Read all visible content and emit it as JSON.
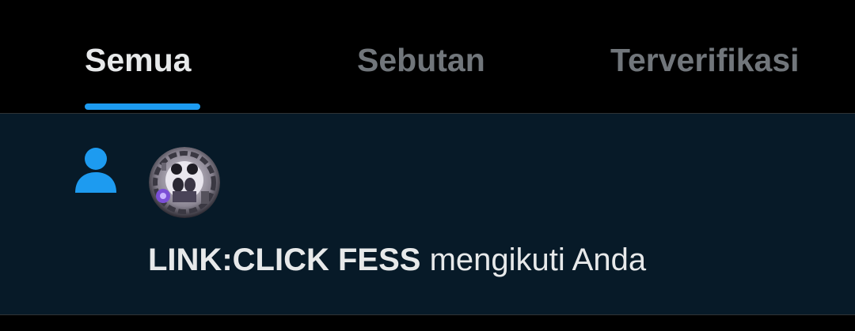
{
  "tabs": {
    "all": "Semua",
    "mentions": "Sebutan",
    "verified": "Terverifikasi",
    "active": "all"
  },
  "colors": {
    "background": "#000000",
    "notification_background": "#071a28",
    "accent": "#1d9bf0",
    "text_primary": "#e7e9ea",
    "text_secondary": "#71767b"
  },
  "notification": {
    "icon": "person-icon",
    "avatar": "account-avatar",
    "actor": "LINK:CLICK FESS",
    "action": "mengikuti Anda"
  }
}
